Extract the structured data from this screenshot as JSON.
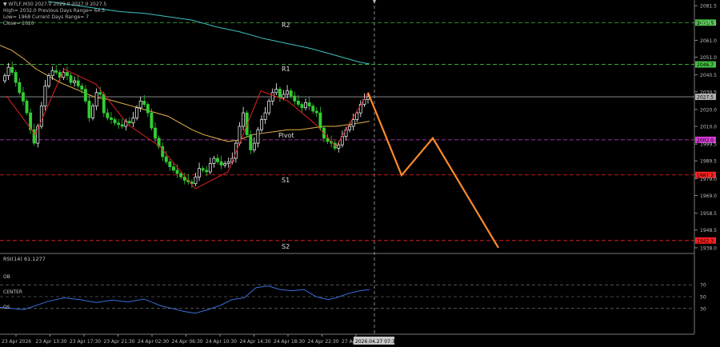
{
  "header": {
    "symbol_line": "▼ WTLF,M30  2027.0 2029.0 2027.0 2027.5",
    "line2": "High= 2032.0    Previous Days Range= 64.5",
    "line3": "Low= 1968    Current Days Range= 7",
    "line4": "Close= 2020"
  },
  "indicator": {
    "label": "RSI(14) 61.1277"
  },
  "colors": {
    "background": "#000000",
    "bull_candle": "#ffffff",
    "bear_candle": "#32cd32",
    "ma_fast": "#e6b44c",
    "ma_slow": "#40c0c0",
    "zigzag": "#dd2222",
    "forecast": "#ff8a2a",
    "rsi_line": "#3a6fd8",
    "level_green": "#40c040",
    "level_red": "#ff2020",
    "level_magenta": "#d63ad6",
    "current_price": "#9a9a9a"
  },
  "chart_data": {
    "type": "candlestick",
    "symbol": "WTLF",
    "timeframe": "M30",
    "ylim": [
      1937,
      2083
    ],
    "price_ticks": [
      "2081.5",
      "2071.5",
      "2061.0",
      "2051.0",
      "2040.5",
      "2030.5",
      "2020.0",
      "2010.0",
      "1999.5",
      "1989.5",
      "1979.0",
      "1969.0",
      "1958.5",
      "1948.5",
      "1938.0"
    ],
    "levels": [
      {
        "name": "R2",
        "price": 2071.5,
        "tag": "2071.5",
        "color": "green"
      },
      {
        "name": "R1",
        "price": 2046.7,
        "tag": "2046.7",
        "color": "green"
      },
      {
        "name": "Pivot",
        "price": 2002.0,
        "tag": "2002.0",
        "color": "magenta"
      },
      {
        "name": "S1",
        "price": 1981.2,
        "tag": "1981.2",
        "color": "red"
      },
      {
        "name": "S2",
        "price": 1942.3,
        "tag": "1942.3",
        "color": "red"
      }
    ],
    "current_price": {
      "price": 2027.5,
      "tag": "2027.5"
    },
    "closes": [
      2040,
      2045,
      2042,
      2036,
      2030,
      2025,
      2018,
      2008,
      2000,
      2010,
      2022,
      2034,
      2040,
      2043,
      2042,
      2039,
      2042,
      2040,
      2036,
      2037,
      2034,
      2032,
      2025,
      2015,
      2022,
      2030,
      2029,
      2018,
      2015,
      2014,
      2012,
      2011,
      2010,
      2013,
      2012,
      2015,
      2021,
      2025,
      2023,
      2018,
      2009,
      2003,
      1998,
      1992,
      1989,
      1986,
      1984,
      1982,
      1980,
      1978,
      1977,
      1976,
      1980,
      1985,
      1984,
      1983,
      1988,
      1991,
      1989,
      1987,
      1988,
      1989,
      1991,
      2000,
      2010,
      2018,
      2005,
      1996,
      2000,
      2008,
      2014,
      2018,
      2025,
      2030,
      2032,
      2027,
      2029,
      2031,
      2028,
      2025,
      2023,
      2021,
      2024,
      2022,
      2019,
      2018,
      2009,
      2003,
      2001,
      2000,
      1997,
      1999,
      2004,
      2008,
      2010,
      2014,
      2018,
      2023,
      2026,
      2027.5
    ],
    "ma_fast": [
      [
        0,
        2058
      ],
      [
        15,
        2055
      ],
      [
        30,
        2050
      ],
      [
        45,
        2044
      ],
      [
        60,
        2040
      ],
      [
        75,
        2036
      ],
      [
        90,
        2033
      ],
      [
        105,
        2030
      ],
      [
        120,
        2027
      ],
      [
        135,
        2026
      ],
      [
        150,
        2024
      ],
      [
        165,
        2022
      ],
      [
        180,
        2020
      ],
      [
        195,
        2018
      ],
      [
        210,
        2016
      ],
      [
        225,
        2012
      ],
      [
        240,
        2008
      ],
      [
        255,
        2005
      ],
      [
        270,
        2003
      ],
      [
        285,
        2001
      ],
      [
        300,
        2002
      ],
      [
        315,
        2005
      ],
      [
        330,
        2006
      ],
      [
        345,
        2007
      ],
      [
        360,
        2008
      ],
      [
        375,
        2008
      ],
      [
        390,
        2009
      ],
      [
        405,
        2010
      ],
      [
        420,
        2010
      ],
      [
        435,
        2011
      ],
      [
        450,
        2012
      ],
      [
        462,
        2013
      ]
    ],
    "ma_slow": [
      [
        60,
        2084
      ],
      [
        90,
        2082
      ],
      [
        120,
        2080
      ],
      [
        150,
        2078
      ],
      [
        180,
        2077
      ],
      [
        210,
        2075
      ],
      [
        240,
        2073
      ],
      [
        270,
        2069
      ],
      [
        300,
        2066
      ],
      [
        330,
        2062
      ],
      [
        360,
        2059
      ],
      [
        390,
        2056
      ],
      [
        420,
        2052
      ],
      [
        450,
        2048
      ],
      [
        462,
        2047
      ]
    ],
    "zigzag": [
      [
        8,
        2028
      ],
      [
        44,
        2005
      ],
      [
        80,
        2044
      ],
      [
        120,
        2035
      ],
      [
        160,
        2011
      ],
      [
        200,
        1998
      ],
      [
        244,
        1973
      ],
      [
        285,
        1983
      ],
      [
        326,
        2031
      ],
      [
        360,
        2025
      ],
      [
        395,
        2011
      ],
      [
        420,
        1998
      ],
      [
        460,
        2030
      ]
    ],
    "forecast": [
      [
        460,
        2030
      ],
      [
        502,
        1981
      ],
      [
        541,
        2003
      ],
      [
        623,
        1938
      ]
    ],
    "time_labels": [
      "23 Apr 2026",
      "23 Apr 13:30",
      "23 Apr 17:30",
      "23 Apr 21:30",
      "24 Apr 02:30",
      "24 Apr 06:30",
      "24 Apr 10:30",
      "24 Apr 14:30",
      "24 Apr 18:30",
      "24 Apr 22:30",
      "27 Apr"
    ],
    "time_highlight": "2026.04.27 07:30",
    "rsi": {
      "ylim": [
        0,
        100
      ],
      "ticks": [
        "70",
        "50",
        "30"
      ],
      "level_labels": {
        "ob": "OB",
        "center": "CENTER",
        "os": "OS"
      },
      "values": [
        [
          0,
          32
        ],
        [
          30,
          28
        ],
        [
          60,
          42
        ],
        [
          80,
          48
        ],
        [
          100,
          45
        ],
        [
          120,
          40
        ],
        [
          140,
          44
        ],
        [
          160,
          41
        ],
        [
          180,
          46
        ],
        [
          200,
          35
        ],
        [
          215,
          30
        ],
        [
          230,
          25
        ],
        [
          244,
          22
        ],
        [
          260,
          28
        ],
        [
          275,
          35
        ],
        [
          290,
          45
        ],
        [
          305,
          48
        ],
        [
          320,
          65
        ],
        [
          335,
          68
        ],
        [
          350,
          62
        ],
        [
          365,
          60
        ],
        [
          380,
          62
        ],
        [
          395,
          50
        ],
        [
          410,
          45
        ],
        [
          420,
          48
        ],
        [
          435,
          55
        ],
        [
          450,
          60
        ],
        [
          462,
          62
        ]
      ]
    }
  }
}
